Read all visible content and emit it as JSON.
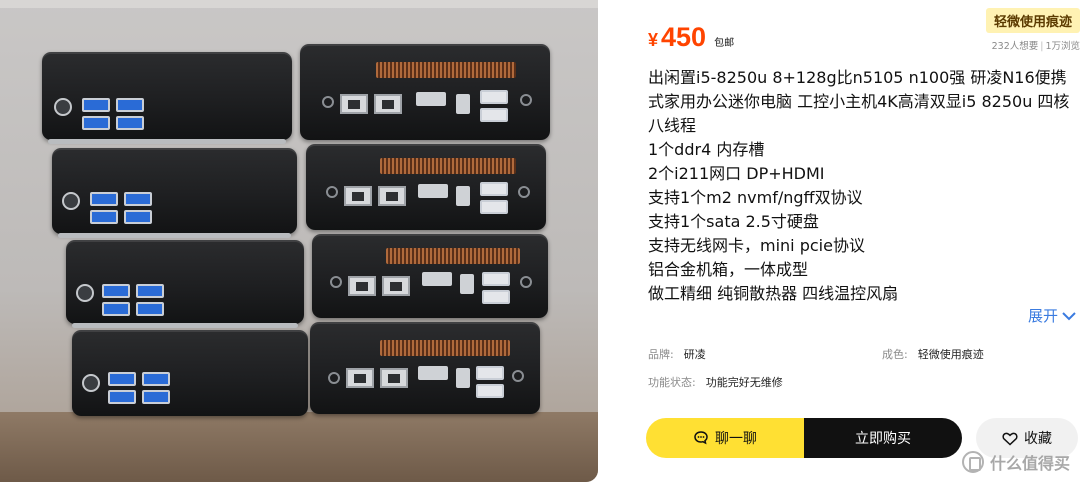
{
  "listing": {
    "currency": "¥",
    "price": "450",
    "shipping": "包邮",
    "condition_badge": "轻微使用痕迹",
    "stats": {
      "wants": "232人想要",
      "views": "1万浏览",
      "separator": "|"
    },
    "description_lines": [
      "出闲置i5-8250u 8+128g比n5105 n100强 研凌N16便携式家用办公迷你电脑 工控小主机4K高清双显i5 8250u 四核八线程",
      "1个ddr4 内存槽",
      "2个i211网口 DP+HDMI",
      "支持1个m2 nvmf/ngff双协议",
      "支持1个sata 2.5寸硬盘",
      "支持无线网卡，mini pcie协议",
      "铝合金机箱，一体成型",
      "做工精细 纯铜散热器 四线温控风扇"
    ],
    "expand_label": "展开",
    "attributes": {
      "brand": {
        "key": "品牌:",
        "value": "研凌"
      },
      "condition": {
        "key": "成色:",
        "value": "轻微使用痕迹"
      },
      "function_state": {
        "key": "功能状态:",
        "value": "功能完好无维修"
      }
    }
  },
  "actions": {
    "chat_label": "聊一聊",
    "buy_label": "立即购买",
    "fav_label": "收藏"
  },
  "watermark": {
    "text": "什么值得买"
  },
  "colors": {
    "price": "#ff4400",
    "chat_button": "#ffe033",
    "buy_button": "#111111",
    "link": "#3a7be0"
  },
  "icons": [
    "chat-bubble-icon",
    "heart-icon",
    "chevron-down-icon"
  ]
}
